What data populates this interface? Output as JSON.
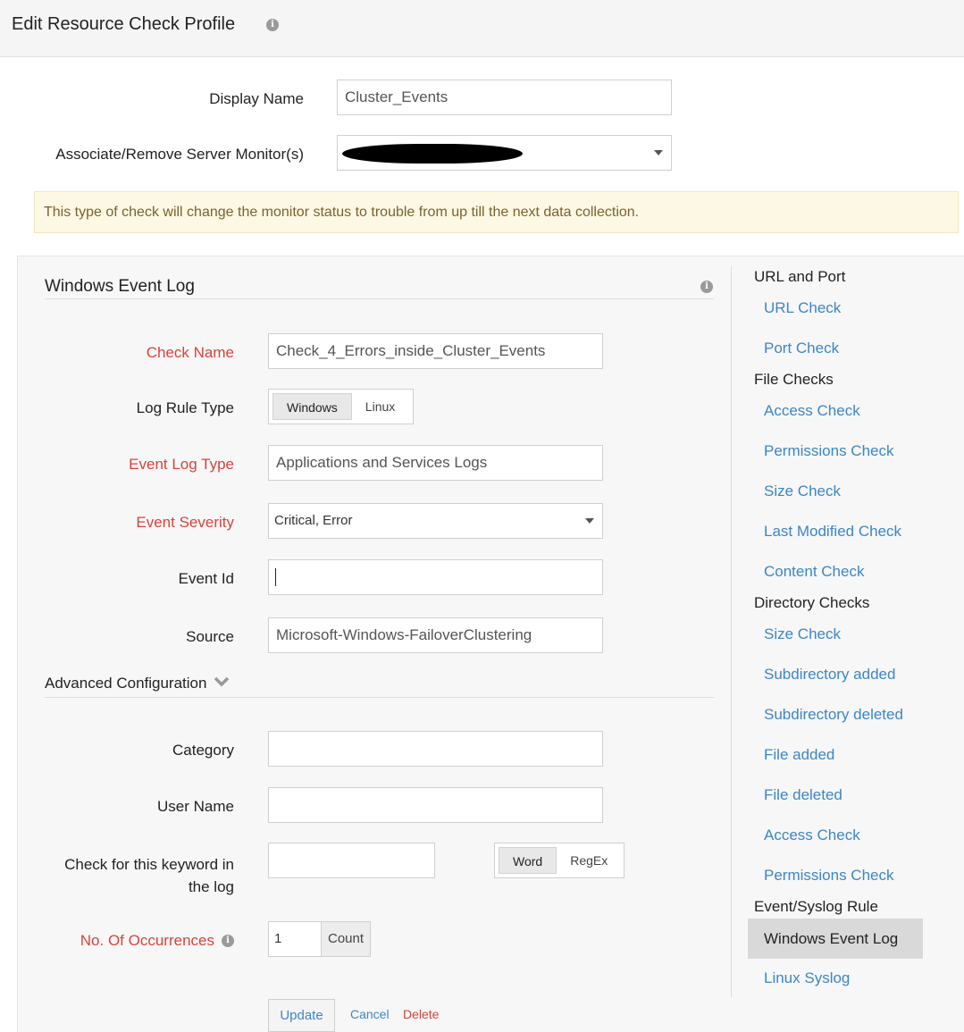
{
  "header": {
    "title": "Edit Resource Check Profile",
    "info_icon": "info-icon"
  },
  "form": {
    "display_name_label": "Display Name",
    "display_name_value": "Cluster_Events",
    "associate_label": "Associate/Remove Server Monitor(s)"
  },
  "warning": "This type of check will change the monitor status to trouble from up till the next data collection.",
  "panel": {
    "title": "Windows Event Log",
    "check_name_label": "Check Name",
    "check_name_value": "Check_4_Errors_inside_Cluster_Events",
    "log_rule_type_label": "Log Rule Type",
    "log_rule_options": [
      "Windows",
      "Linux"
    ],
    "event_log_type_label": "Event Log Type",
    "event_log_type_value": "Applications and Services Logs",
    "event_severity_label": "Event Severity",
    "event_severity_value": "Critical, Error",
    "event_id_label": "Event Id",
    "event_id_value": "",
    "source_label": "Source",
    "source_value": "Microsoft-Windows-FailoverClustering",
    "advanced_label": "Advanced Configuration",
    "category_label": "Category",
    "user_name_label": "User Name",
    "keyword_label_line1": "Check for this keyword in",
    "keyword_label_line2": "the log",
    "keyword_options": [
      "Word",
      "RegEx"
    ],
    "occurrences_label": "No. Of Occurrences",
    "occurrences_value": "1",
    "occurrences_unit": "Count",
    "update_label": "Update",
    "cancel_label": "Cancel",
    "delete_label": "Delete"
  },
  "sidenav": {
    "groups": [
      {
        "heading": "URL and Port",
        "items": [
          "URL Check",
          "Port Check"
        ]
      },
      {
        "heading": "File Checks",
        "items": [
          "Access Check",
          "Permissions Check",
          "Size Check",
          "Last Modified Check",
          "Content Check"
        ]
      },
      {
        "heading": "Directory Checks",
        "items": [
          "Size Check",
          "Subdirectory added",
          "Subdirectory deleted",
          "File added",
          "File deleted",
          "Access Check",
          "Permissions Check"
        ]
      },
      {
        "heading": "Event/Syslog Rule",
        "items": [
          "Windows Event Log",
          "Linux Syslog"
        ]
      }
    ],
    "active_item": "Windows Event Log"
  },
  "colors": {
    "required_label": "#d9433b",
    "link": "#3d86c6",
    "warning_bg": "#fdf8e4",
    "warning_text": "#7a6230",
    "active_nav_bg": "#d9d9d9"
  }
}
